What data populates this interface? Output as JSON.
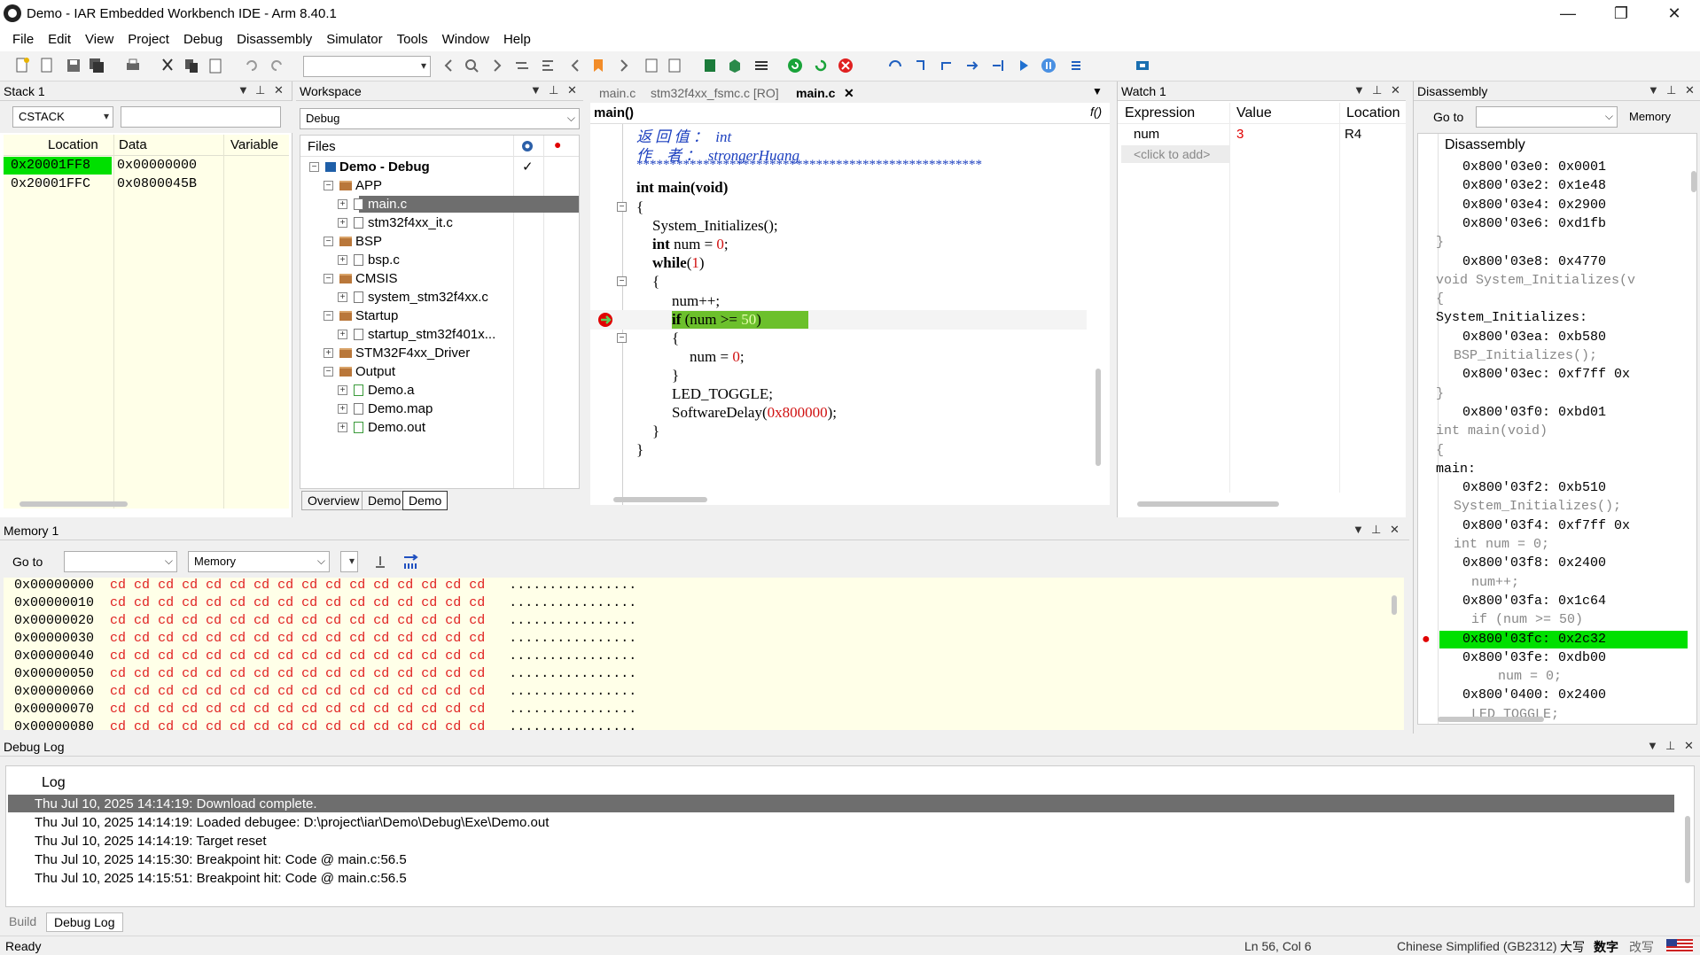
{
  "window": {
    "title": "Demo - IAR Embedded Workbench IDE - Arm 8.40.1",
    "minimize": "—",
    "restore": "❐",
    "close": "✕"
  },
  "menu": [
    "File",
    "Edit",
    "View",
    "Project",
    "Debug",
    "Disassembly",
    "Simulator",
    "Tools",
    "Window",
    "Help"
  ],
  "stack": {
    "title": "Stack 1",
    "selector": "CSTACK",
    "columns": [
      "Location",
      "Data",
      "Variable"
    ],
    "rows": [
      {
        "location": "0x20001FF8",
        "data": "0x00000000",
        "variable": ""
      },
      {
        "location": "0x20001FFC",
        "data": "0x0800045B",
        "variable": ""
      }
    ]
  },
  "workspace": {
    "title": "Workspace",
    "config": "Debug",
    "files_header": "Files",
    "tree": [
      {
        "label": "Demo - Debug",
        "level": 0,
        "kind": "project",
        "check": "✓"
      },
      {
        "label": "APP",
        "level": 1,
        "kind": "folder"
      },
      {
        "label": "main.c",
        "level": 2,
        "kind": "file",
        "selected": true
      },
      {
        "label": "stm32f4xx_it.c",
        "level": 2,
        "kind": "file"
      },
      {
        "label": "BSP",
        "level": 1,
        "kind": "folder"
      },
      {
        "label": "bsp.c",
        "level": 2,
        "kind": "file"
      },
      {
        "label": "CMSIS",
        "level": 1,
        "kind": "folder"
      },
      {
        "label": "system_stm32f4xx.c",
        "level": 2,
        "kind": "file"
      },
      {
        "label": "Startup",
        "level": 1,
        "kind": "folder"
      },
      {
        "label": "startup_stm32f401x...",
        "level": 2,
        "kind": "file"
      },
      {
        "label": "STM32F4xx_Driver",
        "level": 1,
        "kind": "folder"
      },
      {
        "label": "Output",
        "level": 1,
        "kind": "folder"
      },
      {
        "label": "Demo.a",
        "level": 2,
        "kind": "file-green"
      },
      {
        "label": "Demo.map",
        "level": 2,
        "kind": "file"
      },
      {
        "label": "Demo.out",
        "level": 2,
        "kind": "file-green"
      }
    ],
    "bottom_tabs": [
      "Overview",
      "Demo",
      "Demo"
    ]
  },
  "editor": {
    "tabs": [
      "main.c",
      "stm32f4xx_fsmc.c [RO]",
      "main.c"
    ],
    "function": "main()",
    "func_icon": "f()",
    "comment1_label": "返 回 值 ：",
    "comment1_value": "int",
    "comment2_label": "作    者 ：",
    "comment2_value": "strongerHuang",
    "stars": "****************************************************",
    "lines": {
      "l1": "int main(void)",
      "l2": "{",
      "l3": "System_Initializes();",
      "l4_kw": "int",
      "l4_rest": " num = ",
      "l4_num": "0",
      "l4_end": ";",
      "l5_kw": "while",
      "l5_open": "(",
      "l5_num": "1",
      "l5_close": ")",
      "l6": "{",
      "l7": "num++;",
      "l8_kw": "if",
      "l8_rest": " (num >= ",
      "l8_num": "50",
      "l8_end": ")",
      "l9": "{",
      "l10_rest": "num = ",
      "l10_num": "0",
      "l10_end": ";",
      "l11": "}",
      "l12": "LED_TOGGLE;",
      "l13_a": "SoftwareDelay(",
      "l13_num": "0x800000",
      "l13_b": ");",
      "l14": "}",
      "l15": "}"
    }
  },
  "watch": {
    "title": "Watch 1",
    "columns": [
      "Expression",
      "Value",
      "Location"
    ],
    "rows": [
      {
        "expression": "num",
        "value": "3",
        "location": "R4"
      }
    ],
    "add_hint": "<click to add>"
  },
  "disassembly": {
    "title": "Disassembly",
    "goto": "Go to",
    "memory": "Memory",
    "header": "Disassembly",
    "lines": [
      {
        "t": "code",
        "text": "0x800'03e0: 0x0001"
      },
      {
        "t": "code",
        "text": "0x800'03e2: 0x1e48"
      },
      {
        "t": "code",
        "text": "0x800'03e4: 0x2900"
      },
      {
        "t": "code",
        "text": "0x800'03e6: 0xd1fb"
      },
      {
        "t": "src",
        "text": "}"
      },
      {
        "t": "code",
        "text": "0x800'03e8: 0x4770"
      },
      {
        "t": "src",
        "text": "void System_Initializes(v"
      },
      {
        "t": "src",
        "text": "{"
      },
      {
        "t": "label",
        "text": "System_Initializes:"
      },
      {
        "t": "code",
        "text": "0x800'03ea: 0xb580"
      },
      {
        "t": "src2",
        "text": "BSP_Initializes();"
      },
      {
        "t": "code",
        "text": "0x800'03ec: 0xf7ff 0x"
      },
      {
        "t": "src",
        "text": "}"
      },
      {
        "t": "code",
        "text": "0x800'03f0: 0xbd01"
      },
      {
        "t": "src",
        "text": "int main(void)"
      },
      {
        "t": "src",
        "text": "{"
      },
      {
        "t": "label",
        "text": "main:"
      },
      {
        "t": "code",
        "text": "0x800'03f2: 0xb510"
      },
      {
        "t": "src2",
        "text": "System_Initializes();"
      },
      {
        "t": "code",
        "text": "0x800'03f4: 0xf7ff 0x"
      },
      {
        "t": "src2",
        "text": "int num = 0;"
      },
      {
        "t": "code",
        "text": "0x800'03f8: 0x2400"
      },
      {
        "t": "src3",
        "text": "num++;"
      },
      {
        "t": "code",
        "text": "0x800'03fa: 0x1c64"
      },
      {
        "t": "src3",
        "text": "if (num >= 50)"
      },
      {
        "t": "hit",
        "text": "0x800'03fc: 0x2c32"
      },
      {
        "t": "code",
        "text": "0x800'03fe: 0xdb00"
      },
      {
        "t": "src4",
        "text": "num = 0;"
      },
      {
        "t": "code",
        "text": "0x800'0400: 0x2400"
      },
      {
        "t": "src3",
        "text": "LED_TOGGLE;"
      }
    ]
  },
  "memory": {
    "title": "Memory 1",
    "goto": "Go to",
    "zone": "Memory",
    "rows": [
      "0x00000000",
      "0x00000010",
      "0x00000020",
      "0x00000030",
      "0x00000040",
      "0x00000050",
      "0x00000060",
      "0x00000070",
      "0x00000080"
    ],
    "byte": "cd",
    "ascii": "................"
  },
  "debuglog": {
    "title": "Debug Log",
    "header": "Log",
    "lines": [
      "Thu Jul 10, 2025 14:14:19: Download complete.",
      "Thu Jul 10, 2025 14:14:19: Loaded debugee: D:\\project\\iar\\Demo\\Debug\\Exe\\Demo.out",
      "Thu Jul 10, 2025 14:14:19: Target reset",
      "Thu Jul 10, 2025 14:15:30: Breakpoint hit: Code @ main.c:56.5",
      "Thu Jul 10, 2025 14:15:51: Breakpoint hit: Code @ main.c:56.5"
    ],
    "tabs": [
      "Build",
      "Debug Log"
    ]
  },
  "status": {
    "ready": "Ready",
    "position": "Ln 56, Col 6",
    "encoding": "Chinese Simplified (GB2312)",
    "caps": "大写",
    "num": "数字",
    "ovr": "改写"
  },
  "colors": {
    "highlight_green": "#00e000",
    "code_bg": "#ffffe8",
    "selected": "#6e6e6e",
    "breakpoint": "#e00000"
  }
}
